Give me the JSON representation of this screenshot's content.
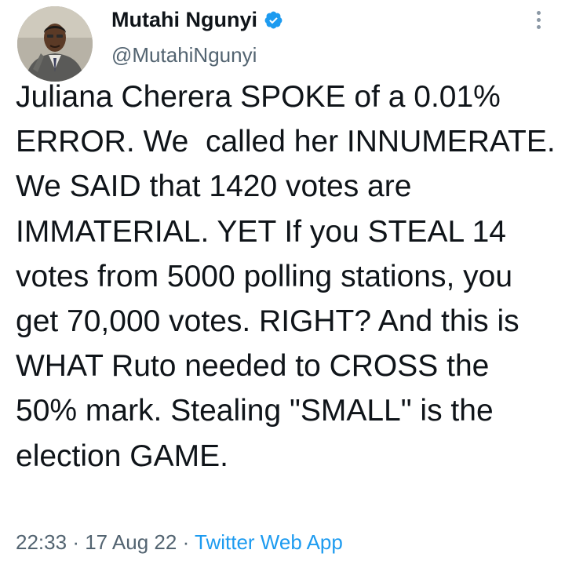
{
  "author": {
    "display_name": "Mutahi Ngunyi",
    "handle": "@MutahiNgunyi",
    "verified": true,
    "verified_icon": "verified-badge-icon",
    "more_icon": "more-options-icon"
  },
  "tweet": {
    "text": "Juliana Cherera SPOKE of a 0.01% ERROR. We  called her INNUMERATE. We SAID that 1420 votes are IMMATERIAL. YET If you STEAL 14 votes from 5000 polling stations, you get 70,000 votes. RIGHT? And this is WHAT Ruto needed to CROSS the 50% mark. Stealing \"SMALL\" is the election GAME.",
    "time": "22:33",
    "separator": "·",
    "date": "17 Aug 22",
    "source": "Twitter Web App"
  },
  "colors": {
    "text": "#0f1419",
    "secondary": "#536471",
    "accent": "#1d9bf0"
  }
}
